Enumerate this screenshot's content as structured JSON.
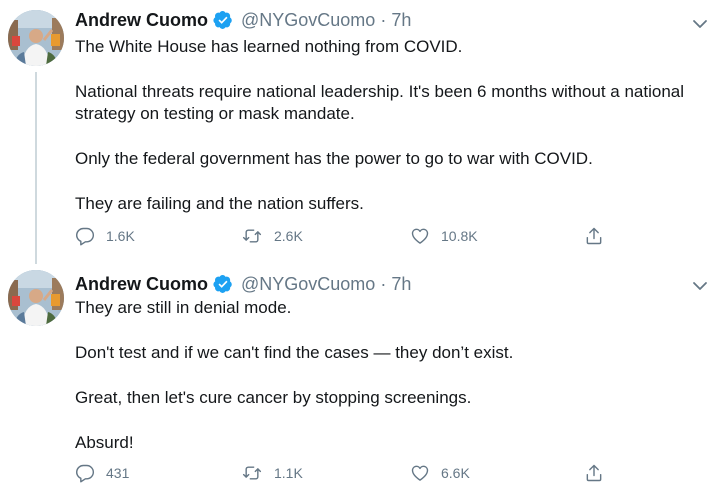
{
  "colors": {
    "text": "#14171a",
    "secondary": "#657786",
    "verified": "#1da1f2",
    "thread_line": "#cfd9de"
  },
  "tweets": [
    {
      "author": {
        "name": "Andrew Cuomo",
        "handle": "@NYGovCuomo",
        "verified_icon": "verified-badge-icon"
      },
      "separator": "·",
      "time": "7h",
      "paragraphs": [
        "The White House has learned nothing from COVID.",
        "National threats require national leadership. It's been 6 months without a national strategy on testing or mask mandate.",
        "Only the federal government has the power to go to war with COVID.",
        "They are failing and the nation suffers."
      ],
      "stats": {
        "replies": "1.6K",
        "retweets": "2.6K",
        "likes": "10.8K"
      }
    },
    {
      "author": {
        "name": "Andrew Cuomo",
        "handle": "@NYGovCuomo",
        "verified_icon": "verified-badge-icon"
      },
      "separator": "·",
      "time": "7h",
      "paragraphs": [
        "They are still in denial mode.",
        "Don't test and if we can't find the cases — they don’t exist.",
        "Great, then let's cure cancer by stopping screenings.",
        "Absurd!"
      ],
      "stats": {
        "replies": "431",
        "retweets": "1.1K",
        "likes": "6.6K"
      }
    }
  ]
}
